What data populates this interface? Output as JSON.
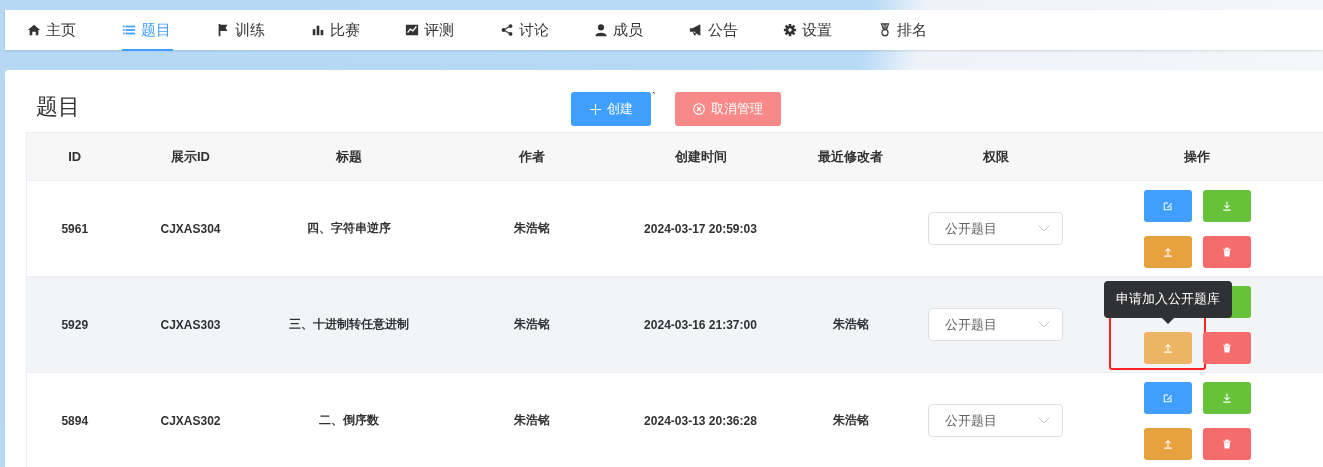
{
  "nav": {
    "items": [
      {
        "label": "主页",
        "kind": "home",
        "selected": false
      },
      {
        "label": "题目",
        "kind": "list",
        "selected": true
      },
      {
        "label": "训练",
        "kind": "flag",
        "selected": false
      },
      {
        "label": "比赛",
        "kind": "bars",
        "selected": false
      },
      {
        "label": "评测",
        "kind": "chart",
        "selected": false
      },
      {
        "label": "讨论",
        "kind": "share",
        "selected": false
      },
      {
        "label": "成员",
        "kind": "user",
        "selected": false
      },
      {
        "label": "公告",
        "kind": "bullhorn",
        "selected": false
      },
      {
        "label": "设置",
        "kind": "gear",
        "selected": false
      },
      {
        "label": "排名",
        "kind": "medal",
        "selected": false
      }
    ]
  },
  "page": {
    "title": "题目",
    "create_button": "创建",
    "stray_mark": "`",
    "cancel_button": "取消管理"
  },
  "table": {
    "columns": [
      "ID",
      "展示ID",
      "标题",
      "作者",
      "创建时间",
      "最近修改者",
      "权限",
      "操作"
    ],
    "rows": [
      {
        "id": "5961",
        "display_id": "CJXAS304",
        "title": "四、字符串逆序",
        "author": "朱浩铭",
        "created": "2024-03-17 20:59:03",
        "modifier": "",
        "permission": "公开题目",
        "hovered": false,
        "actions": [
          {
            "kind": "edit",
            "hovered": false
          },
          {
            "kind": "download",
            "hovered": false
          },
          {
            "kind": "upload",
            "hovered": false
          },
          {
            "kind": "delete",
            "hovered": false
          }
        ]
      },
      {
        "id": "5929",
        "display_id": "CJXAS303",
        "title": "三、十进制转任意进制",
        "author": "朱浩铭",
        "created": "2024-03-16 21:37:00",
        "modifier": "朱浩铭",
        "permission": "公开题目",
        "hovered": true,
        "actions": [
          {
            "kind": "download",
            "hovered": false
          },
          {
            "kind": "upload",
            "hovered": true,
            "highlighted": true,
            "tooltip": "申请加入公开题库"
          },
          {
            "kind": "delete",
            "hovered": false
          }
        ]
      },
      {
        "id": "5894",
        "display_id": "CJXAS302",
        "title": "二、倒序数",
        "author": "朱浩铭",
        "created": "2024-03-13 20:36:28",
        "modifier": "朱浩铭",
        "permission": "公开题目",
        "hovered": false,
        "actions": [
          {
            "kind": "edit",
            "hovered": false
          },
          {
            "kind": "download",
            "hovered": false
          },
          {
            "kind": "upload",
            "hovered": false
          },
          {
            "kind": "delete",
            "hovered": false
          }
        ]
      }
    ]
  }
}
